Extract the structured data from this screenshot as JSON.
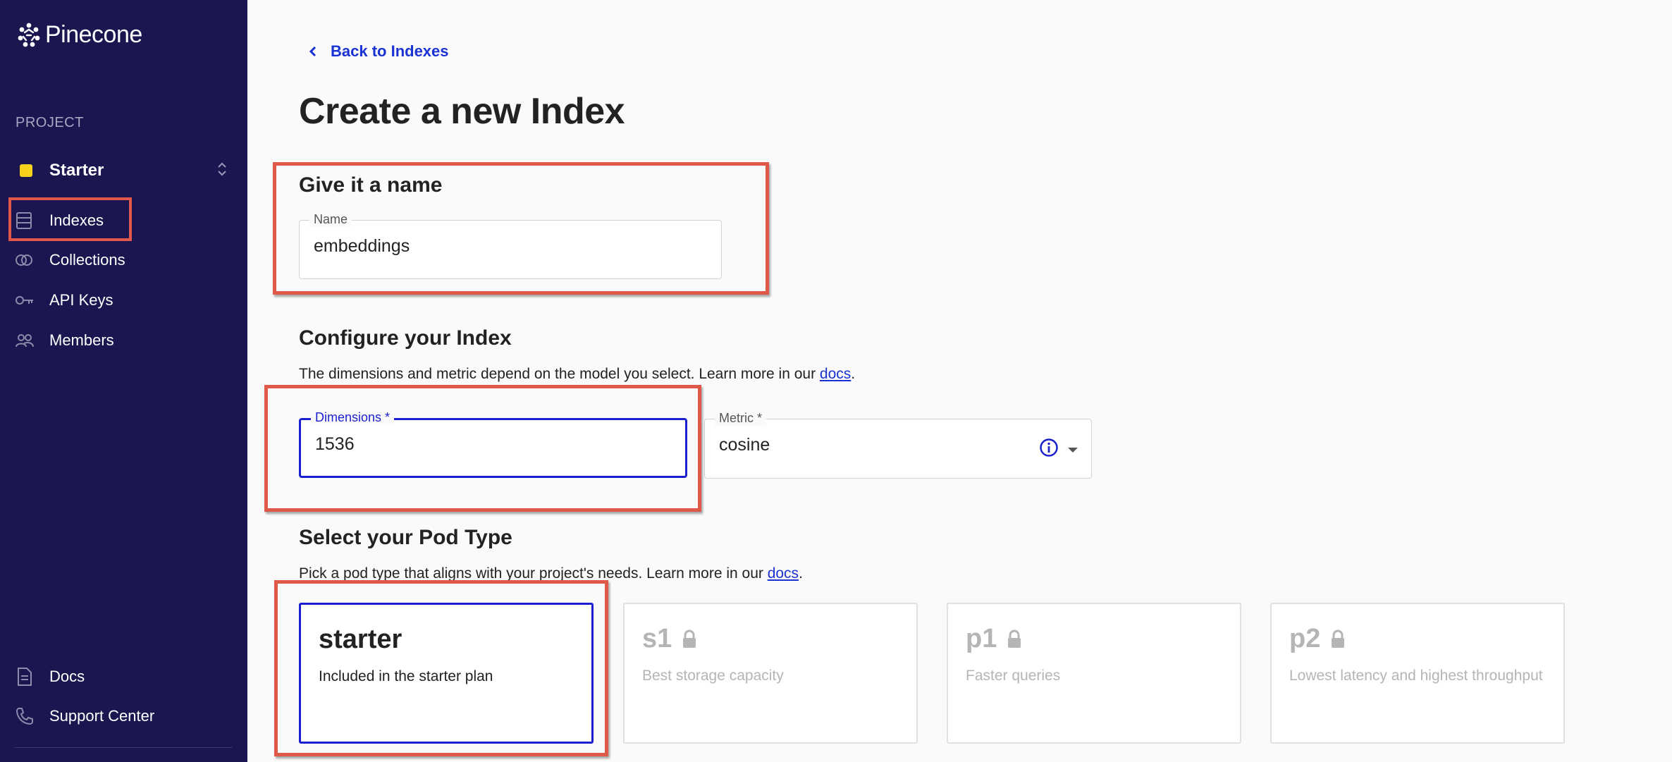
{
  "app": {
    "brand": "Pinecone"
  },
  "sidebar": {
    "section_label": "PROJECT",
    "project_name": "Starter",
    "project_color": "#f7d21c",
    "items": [
      {
        "label": "Indexes",
        "icon": "table-icon"
      },
      {
        "label": "Collections",
        "icon": "collections-icon"
      },
      {
        "label": "API Keys",
        "icon": "key-icon"
      },
      {
        "label": "Members",
        "icon": "members-icon"
      }
    ],
    "bottom_items": [
      {
        "label": "Docs",
        "icon": "document-icon"
      },
      {
        "label": "Support Center",
        "icon": "phone-icon"
      }
    ]
  },
  "main": {
    "back_link": "Back to Indexes",
    "title": "Create a new Index",
    "name_section": {
      "heading": "Give it a name",
      "name_label": "Name",
      "name_value": "embeddings"
    },
    "config_section": {
      "heading": "Configure your Index",
      "description": "The dimensions and metric depend on the model you select. Learn more in our ",
      "link": "docs",
      "dimensions_label": "Dimensions *",
      "dimensions_value": "1536",
      "metric_label": "Metric *",
      "metric_value": "cosine"
    },
    "pod_section": {
      "heading": "Select your Pod Type",
      "description": "Pick a pod type that aligns with your project's needs. Learn more in our ",
      "link": "docs",
      "pods": [
        {
          "name": "starter",
          "description": "Included in the starter plan",
          "locked": false,
          "selected": true
        },
        {
          "name": "s1",
          "description": "Best storage capacity",
          "locked": true,
          "selected": false
        },
        {
          "name": "p1",
          "description": "Faster queries",
          "locked": true,
          "selected": false
        },
        {
          "name": "p2",
          "description": "Lowest latency and highest throughput",
          "locked": true,
          "selected": false
        }
      ]
    }
  },
  "colors": {
    "sidebar_bg": "#1b1650",
    "accent": "#1a1fd0",
    "highlight_box": "#e0584a"
  }
}
